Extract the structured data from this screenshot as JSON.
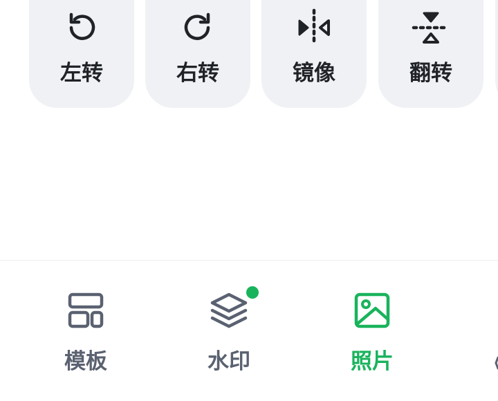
{
  "colors": {
    "tile_bg": "#f0f1f4",
    "tile_text": "#1f2227",
    "nav_inactive": "#5a6170",
    "nav_active": "#19b35c",
    "badge": "#19b35c"
  },
  "tools": [
    {
      "label": "左转",
      "icon": "rotate-left-icon"
    },
    {
      "label": "右转",
      "icon": "rotate-right-icon"
    },
    {
      "label": "镜像",
      "icon": "mirror-icon"
    },
    {
      "label": "翻转",
      "icon": "flip-vertical-icon"
    }
  ],
  "nav": {
    "items": [
      {
        "label": "模板",
        "icon": "template-icon",
        "active": false
      },
      {
        "label": "水印",
        "icon": "layers-icon",
        "active": false,
        "badge": true
      },
      {
        "label": "照片",
        "icon": "image-icon",
        "active": true
      }
    ]
  }
}
